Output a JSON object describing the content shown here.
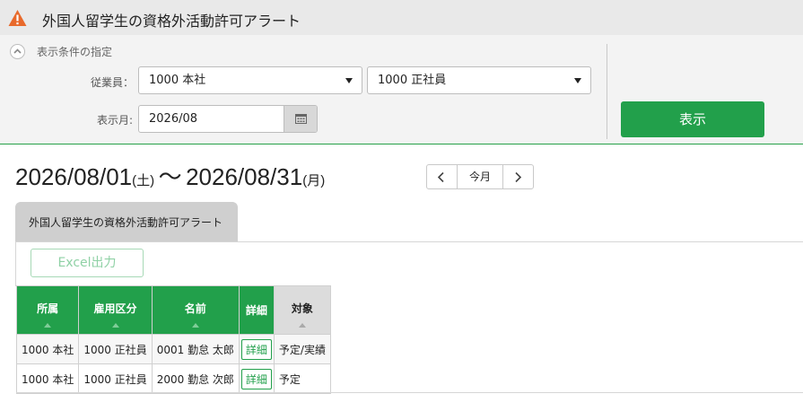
{
  "window": {
    "title": "外国人留学生の資格外活動許可アラート",
    "icon": "warning-triangle-icon",
    "accent": "#22a04b"
  },
  "filter": {
    "section_title": "表示条件の指定",
    "employee_label": "従業員：",
    "employee_org_value": "1000 本社",
    "employee_type_value": "1000 正社員",
    "month_label": "表示月:",
    "month_value": "2026/08",
    "show_button": "表示"
  },
  "period": {
    "start": "2026/08/01",
    "start_dow": "(土)",
    "separator": "〜",
    "end": "2026/08/31",
    "end_dow": "(月)",
    "today_button": "今月"
  },
  "tab": {
    "label": "外国人留学生の資格外活動許可アラート"
  },
  "toolbar": {
    "excel_button": "Excel出力"
  },
  "table": {
    "headers": [
      "所属",
      "雇用区分",
      "名前",
      "詳細",
      "対象"
    ],
    "rows": [
      {
        "dept": "1000 本社",
        "employment": "1000 正社員",
        "name": "0001 勤怠 太郎",
        "detail": "詳細",
        "target": "予定/実績"
      },
      {
        "dept": "1000 本社",
        "employment": "1000 正社員",
        "name": "2000 勤怠 次郎",
        "detail": "詳細",
        "target": "予定"
      }
    ]
  }
}
